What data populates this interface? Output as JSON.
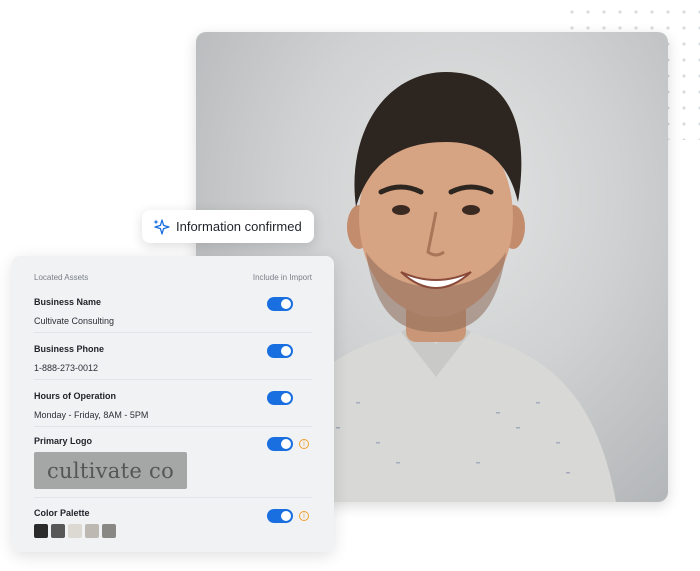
{
  "pill": {
    "text": "Information confirmed",
    "icon": "sparkle-icon"
  },
  "panel": {
    "header_left": "Located Assets",
    "header_right": "Include in Import",
    "rows": [
      {
        "label": "Business Name",
        "value": "Cultivate Consulting",
        "included": true
      },
      {
        "label": "Business Phone",
        "value": "1-888-273-0012",
        "included": true
      },
      {
        "label": "Hours of Operation",
        "value": "Monday - Friday, 8AM - 5PM",
        "included": true
      },
      {
        "label": "Primary Logo",
        "value": "",
        "included": true,
        "info": true
      },
      {
        "label": "Color Palette",
        "value": "",
        "included": true,
        "info": true
      }
    ],
    "logo_text": "cultivate co",
    "palette": [
      "#2b2b2b",
      "#585858",
      "#dcd8d2",
      "#bdb9b2",
      "#8a8884"
    ]
  },
  "colors": {
    "accent": "#1a6fe0",
    "info": "#f0a02a"
  },
  "info_glyph": "i"
}
